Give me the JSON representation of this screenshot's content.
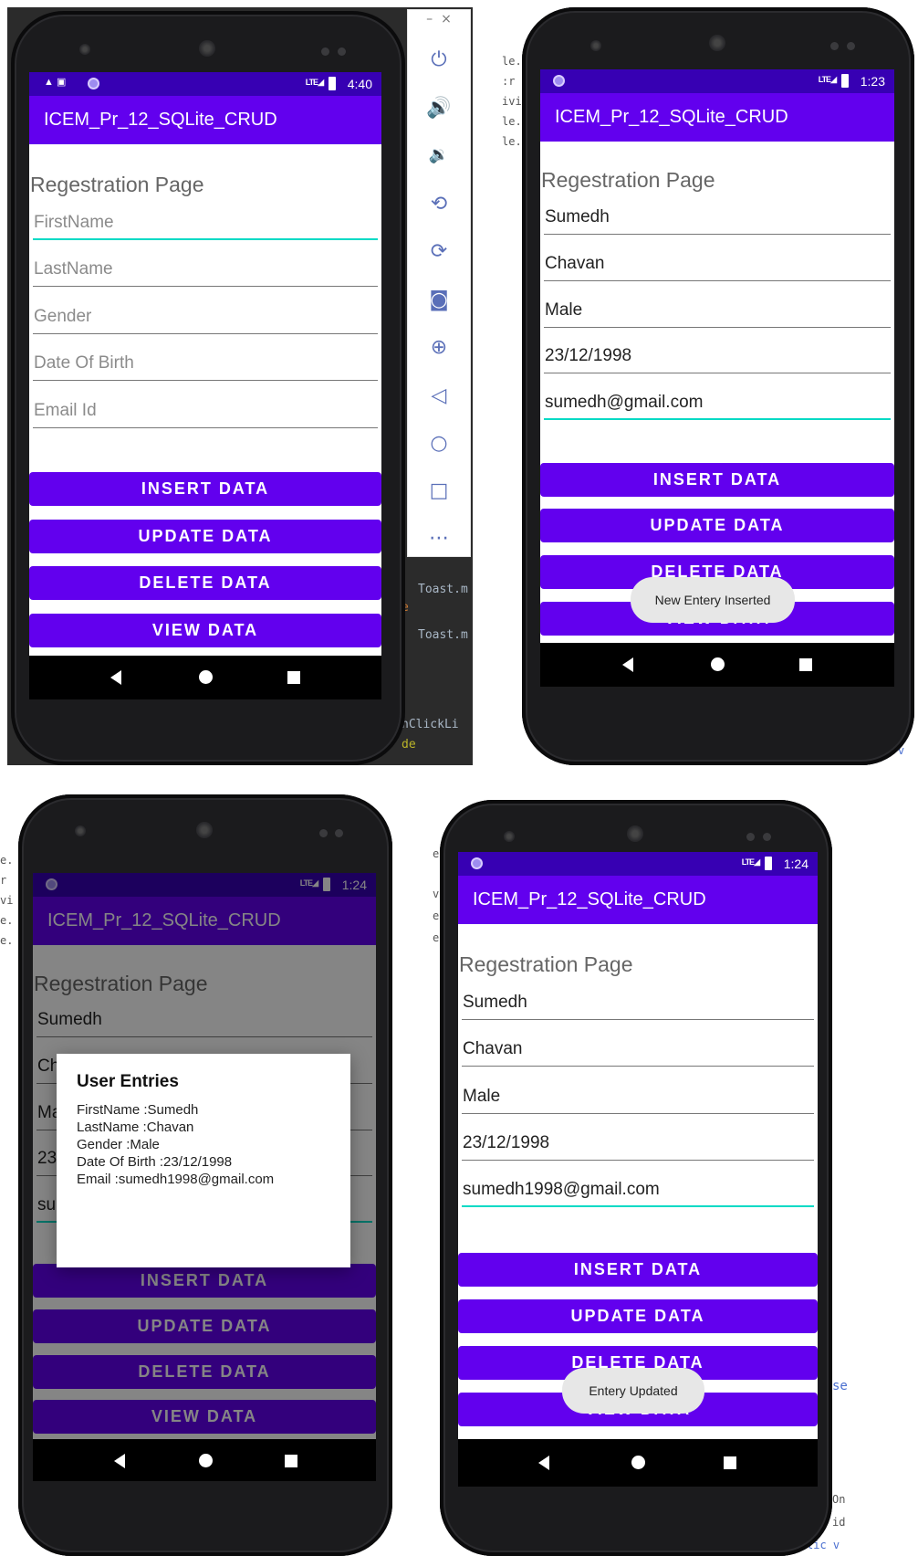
{
  "app_title": "ICEM_Pr_12_SQLite_CRUD",
  "page_title": "Regestration Page",
  "buttons": {
    "insert": "INSERT DATA",
    "update": "UPDATE DATA",
    "delete": "DELETE DATA",
    "view": "VIEW DATA"
  },
  "hints": {
    "first_name": "FirstName",
    "last_name": "LastName",
    "gender": "Gender",
    "dob": "Date Of Birth",
    "email": "Email Id"
  },
  "screens": [
    {
      "time": "4:40"
    },
    {
      "time": "1:23",
      "values": {
        "first_name": "Sumedh",
        "last_name": "Chavan",
        "gender": "Male",
        "dob": "23/12/1998",
        "email": "sumedh@gmail.com"
      },
      "toast": "New Entery Inserted"
    },
    {
      "time": "1:24",
      "values": {
        "first_name": "Sumedh",
        "last_name": "Ch",
        "gender": "Ma",
        "dob": "23",
        "email": "su"
      },
      "dialog": {
        "title": "User Entries",
        "lines": [
          "FirstName :Sumedh",
          "LastName :Chavan",
          "Gender :Male",
          "Date Of Birth :23/12/1998",
          "Email :sumedh1998@gmail.com"
        ]
      }
    },
    {
      "time": "1:24",
      "values": {
        "first_name": "Sumedh",
        "last_name": "Chavan",
        "gender": "Male",
        "dob": "23/12/1998",
        "email": "sumedh1998@gmail.com"
      },
      "toast": "Entery Updated"
    }
  ],
  "code_fragments": {
    "toast_1": "Toast.m",
    "toast_2": "Toast.m",
    "onclick": "nClickLi",
    "de": "de",
    "on": "On",
    "id": "id",
    "lic": "lic v",
    "se": "se"
  },
  "emulator_icons": [
    "power-icon",
    "volume-up-icon",
    "volume-down-icon",
    "rotate-left-icon",
    "rotate-right-icon",
    "camera-icon",
    "zoom-icon",
    "back-icon",
    "home-icon",
    "overview-icon",
    "more-icon"
  ]
}
